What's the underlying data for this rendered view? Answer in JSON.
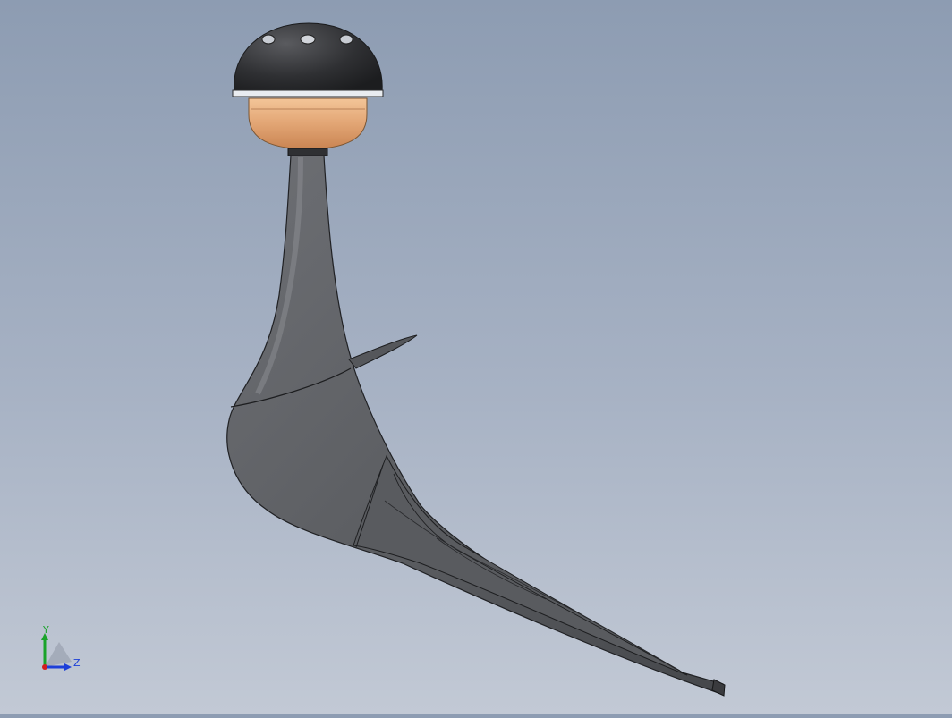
{
  "viewport": {
    "model_name": "hip-stem-implant-model",
    "colors": {
      "background_top": "#8d9cb2",
      "background_bottom": "#c2c9d5",
      "cap": "#3a3b3e",
      "liner": "#e4a878",
      "stem": "#5e6064",
      "edge": "#1f2022"
    }
  },
  "triad": {
    "y_label": "Y",
    "z_label": "Z",
    "y_color": "#1aa32a",
    "z_color": "#1d3fd8",
    "x_color": "#d21e1e"
  }
}
